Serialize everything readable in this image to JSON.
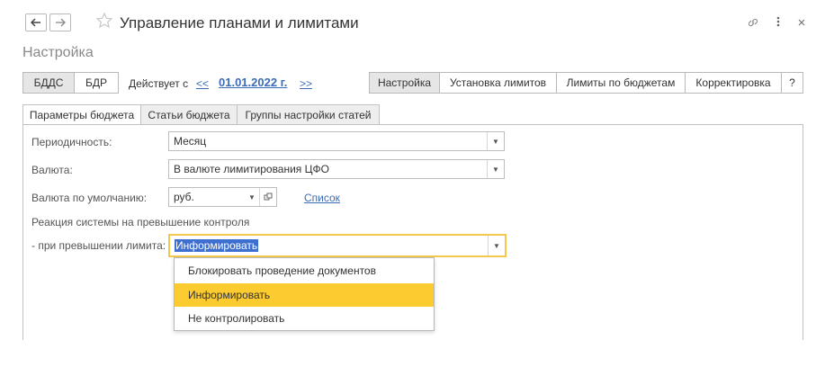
{
  "window": {
    "title": "Управление планами и лимитами",
    "subtitle": "Настройка",
    "icons": [
      "back-arrow-icon",
      "forward-arrow-icon",
      "star-icon",
      "link-icon",
      "more-icon",
      "close-icon"
    ]
  },
  "toolbar": {
    "segments": [
      "БДДС",
      "БДР"
    ],
    "active_segment": "БДДС",
    "effective_label": "Действует с",
    "prev_link": "<<",
    "date": "01.01.2022 г.",
    "next_link": ">>",
    "right_tabs": [
      "Настройка",
      "Установка лимитов",
      "Лимиты по бюджетам",
      "Корректировка",
      "?"
    ],
    "active_right_tab": "Настройка"
  },
  "tabs": {
    "items": [
      "Параметры бюджета",
      "Статьи бюджета",
      "Группы настройки статей"
    ],
    "active": "Параметры бюджета"
  },
  "form": {
    "periodicity_label": "Периодичность:",
    "periodicity_value": "Месяц",
    "currency_label": "Валюта:",
    "currency_value": "В валюте лимитирования ЦФО",
    "default_currency_label": "Валюта по умолчанию:",
    "default_currency_value": "руб.",
    "list_link": "Список",
    "reaction_heading": "Реакция системы на превышение контроля",
    "limit_exceed_label": "- при превышении лимита:",
    "limit_exceed_value": "Информировать"
  },
  "dropdown": {
    "options": [
      "Блокировать проведение документов",
      "Информировать",
      "Не контролировать"
    ],
    "selected": "Информировать"
  },
  "colors": {
    "accent": "#fbcb2f",
    "link": "#3b6cb5",
    "focus_border": "#f2c94c",
    "selection": "#3d6fd1"
  }
}
